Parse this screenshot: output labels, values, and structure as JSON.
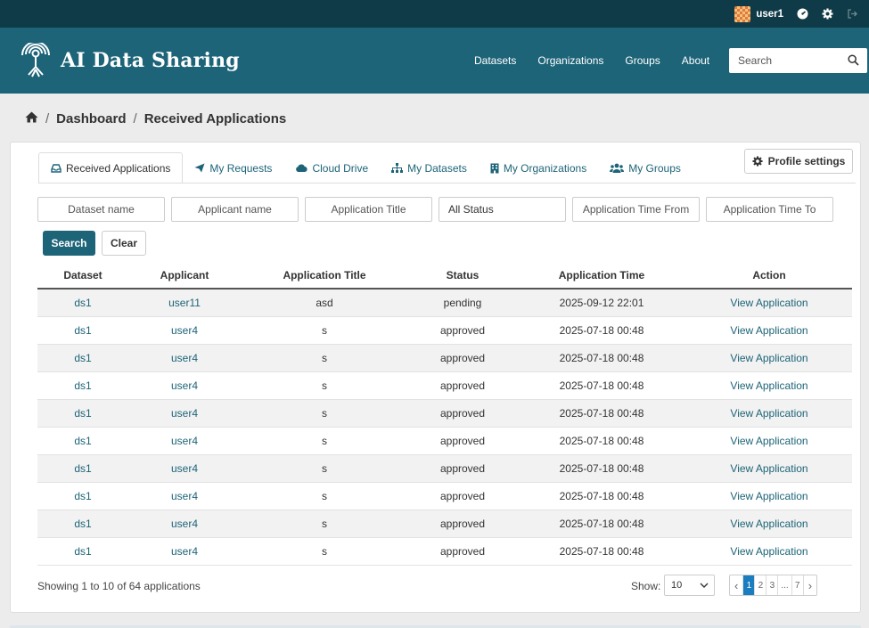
{
  "account": {
    "username": "user1"
  },
  "masthead": {
    "site_title": "AI Data Sharing",
    "nav": [
      "Datasets",
      "Organizations",
      "Groups",
      "About"
    ],
    "search_placeholder": "Search",
    "brand_color": "#1d6478"
  },
  "breadcrumb": {
    "items": [
      "Dashboard",
      "Received Applications"
    ]
  },
  "tabs": [
    {
      "label": "Received Applications",
      "icon": "inbox-icon",
      "active": true
    },
    {
      "label": "My Requests",
      "icon": "send-icon",
      "active": false
    },
    {
      "label": "Cloud Drive",
      "icon": "cloud-icon",
      "active": false
    },
    {
      "label": "My Datasets",
      "icon": "sitemap-icon",
      "active": false
    },
    {
      "label": "My Organizations",
      "icon": "building-icon",
      "active": false
    },
    {
      "label": "My Groups",
      "icon": "users-icon",
      "active": false
    }
  ],
  "profile_button": "Profile settings",
  "filters": {
    "dataset": "Dataset name",
    "applicant": "Applicant name",
    "title": "Application Title",
    "status": "All Status",
    "time_from": "Application Time From",
    "time_to": "Application Time To"
  },
  "buttons": {
    "search": "Search",
    "clear": "Clear"
  },
  "table": {
    "headers": [
      "Dataset",
      "Applicant",
      "Application Title",
      "Status",
      "Application Time",
      "Action"
    ],
    "rows": [
      [
        "ds1",
        "user11",
        "asd",
        "pending",
        "2025-09-12 22:01",
        "View Application"
      ],
      [
        "ds1",
        "user4",
        "s",
        "approved",
        "2025-07-18 00:48",
        "View Application"
      ],
      [
        "ds1",
        "user4",
        "s",
        "approved",
        "2025-07-18 00:48",
        "View Application"
      ],
      [
        "ds1",
        "user4",
        "s",
        "approved",
        "2025-07-18 00:48",
        "View Application"
      ],
      [
        "ds1",
        "user4",
        "s",
        "approved",
        "2025-07-18 00:48",
        "View Application"
      ],
      [
        "ds1",
        "user4",
        "s",
        "approved",
        "2025-07-18 00:48",
        "View Application"
      ],
      [
        "ds1",
        "user4",
        "s",
        "approved",
        "2025-07-18 00:48",
        "View Application"
      ],
      [
        "ds1",
        "user4",
        "s",
        "approved",
        "2025-07-18 00:48",
        "View Application"
      ],
      [
        "ds1",
        "user4",
        "s",
        "approved",
        "2025-07-18 00:48",
        "View Application"
      ],
      [
        "ds1",
        "user4",
        "s",
        "approved",
        "2025-07-18 00:48",
        "View Application"
      ]
    ]
  },
  "footer": {
    "showing": "Showing 1 to 10 of 64 applications",
    "show_label": "Show:",
    "page_size": "10",
    "pages": [
      "1",
      "2",
      "3",
      "...",
      "7"
    ],
    "current_page": "1"
  }
}
